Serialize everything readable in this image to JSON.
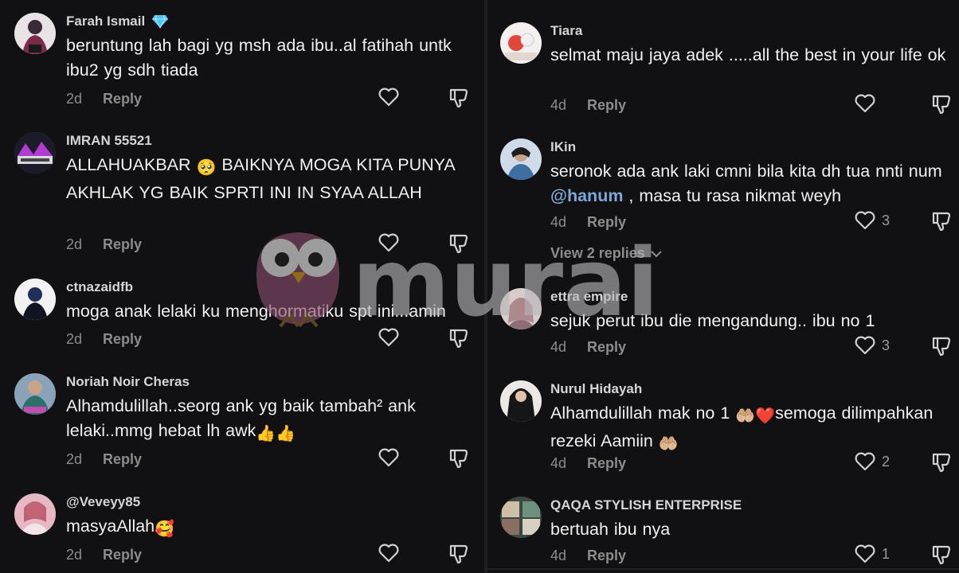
{
  "left_comments": [
    {
      "username": "Farah Ismail",
      "verified_badge": "diamond-icon",
      "text": "beruntung lah bagi yg msh ada ibu..al fatihah untk ibu2 yg sdh tiada",
      "time": "2d",
      "reply": "Reply"
    },
    {
      "username": "IMRAN 55521",
      "text_a": "ALLAHUAKBAR",
      "emoji": "🥺",
      "text_b": "BAIKNYA MOGA KITA PUNYA AKHLAK YG BAIK SPRTI INI IN SYAA ALLAH",
      "time": "2d",
      "reply": "Reply"
    },
    {
      "username": "ctnazaidfb",
      "text": "moga anak lelaki ku menghormatiku spt ini...amin",
      "time": "2d",
      "reply": "Reply"
    },
    {
      "username": "Noriah Noir Cheras",
      "text": "Alhamdulillah..seorg ank yg baik tambah² ank lelaki..mmg hebat lh awk",
      "emoji": "👍👍",
      "time": "2d",
      "reply": "Reply"
    },
    {
      "username": "@Veveyy85",
      "text": "masyaAllah",
      "emoji": "🥰",
      "time": "2d",
      "reply": "Reply"
    }
  ],
  "right_comments": [
    {
      "username": "Tiara",
      "text": "selmat maju jaya adek .....all the best in your life ok",
      "time": "4d",
      "reply": "Reply",
      "likes": ""
    },
    {
      "username": "IKin",
      "text_a": "seronok ada ank laki cmni bila kita dh tua nnti num ",
      "mention": "@hanum",
      "text_b": " , masa tu rasa nikmat weyh",
      "time": "4d",
      "reply": "Reply",
      "likes": "3"
    },
    {
      "username": "ettra empire",
      "text": "sejuk perut ibu die mengandung.. ibu no 1",
      "time": "4d",
      "reply": "Reply",
      "likes": "3"
    },
    {
      "username": "Nurul Hidayah",
      "text_a": "Alhamdulillah mak no 1 ",
      "emoji_a": "🤲🏼❤️",
      "text_b": "semoga dilimpahkan rezeki Aamiin ",
      "emoji_b": "🤲🏼",
      "time": "4d",
      "reply": "Reply",
      "likes": "2"
    },
    {
      "username": "QAQA STYLISH ENTERPRISE",
      "text": "bertuah ibu nya",
      "time": "4d",
      "reply": "Reply",
      "likes": "1"
    }
  ],
  "view_replies": "View 2 replies",
  "watermark": {
    "brand": "murai"
  },
  "colors": {
    "background": "#111113",
    "text": "#f1f1f1",
    "muted": "#8c8c8c",
    "mention": "#7fa7d6",
    "owl": "#8a4f6e",
    "badge": "#4fc3f7"
  }
}
